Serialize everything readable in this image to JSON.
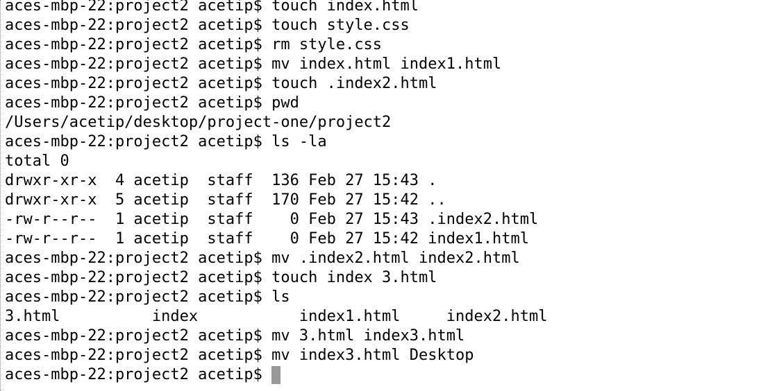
{
  "terminal": {
    "prompt": "aces-mbp-22:project2 acetip$ ",
    "lines": [
      {
        "type": "cmd",
        "text": "touch index.html"
      },
      {
        "type": "cmd",
        "text": "touch style.css"
      },
      {
        "type": "cmd",
        "text": "rm style.css"
      },
      {
        "type": "cmd",
        "text": "mv index.html index1.html"
      },
      {
        "type": "cmd",
        "text": "touch .index2.html"
      },
      {
        "type": "cmd",
        "text": "pwd"
      },
      {
        "type": "out",
        "text": "/Users/acetip/desktop/project-one/project2"
      },
      {
        "type": "cmd",
        "text": "ls -la"
      },
      {
        "type": "out",
        "text": "total 0"
      },
      {
        "type": "out",
        "text": "drwxr-xr-x  4 acetip  staff  136 Feb 27 15:43 ."
      },
      {
        "type": "out",
        "text": "drwxr-xr-x  5 acetip  staff  170 Feb 27 15:42 .."
      },
      {
        "type": "out",
        "text": "-rw-r--r--  1 acetip  staff    0 Feb 27 15:43 .index2.html"
      },
      {
        "type": "out",
        "text": "-rw-r--r--  1 acetip  staff    0 Feb 27 15:42 index1.html"
      },
      {
        "type": "cmd",
        "text": "mv .index2.html index2.html"
      },
      {
        "type": "cmd",
        "text": "touch index 3.html"
      },
      {
        "type": "cmd",
        "text": "ls"
      },
      {
        "type": "out",
        "text": "3.html          index           index1.html     index2.html"
      },
      {
        "type": "cmd",
        "text": "mv 3.html index3.html"
      },
      {
        "type": "cmd",
        "text": "mv index3.html Desktop"
      },
      {
        "type": "prompt-active",
        "text": ""
      }
    ]
  }
}
